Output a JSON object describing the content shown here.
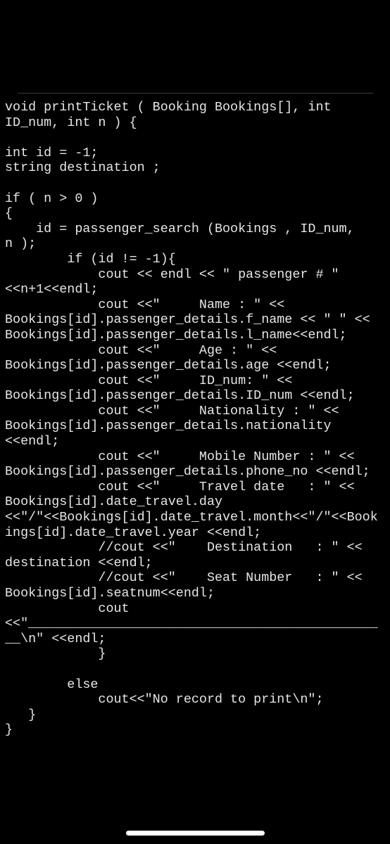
{
  "code_lines": [
    "void printTicket ( Booking Bookings[], int",
    "ID_num, int n ) {",
    "",
    "int id = -1;",
    "string destination ;",
    "",
    "if ( n > 0 )",
    "{",
    "    id = passenger_search (Bookings , ID_num,",
    "n );",
    "        if (id != -1){",
    "            cout << endl << \" passenger # \"",
    "<<n+1<<endl;",
    "            cout <<\"     Name : \" <<",
    "Bookings[id].passenger_details.f_name << \" \" <<",
    "Bookings[id].passenger_details.l_name<<endl;",
    "            cout <<\"     Age : \" <<",
    "Bookings[id].passenger_details.age <<endl;",
    "            cout <<\"     ID_num: \" <<",
    "Bookings[id].passenger_details.ID_num <<endl;",
    "            cout <<\"     Nationality : \" <<",
    "Bookings[id].passenger_details.nationality",
    "<<endl;",
    "            cout <<\"     Mobile Number : \" <<",
    "Bookings[id].passenger_details.phone_no <<endl;",
    "            cout <<\"     Travel date   : \" <<",
    "Bookings[id].date_travel.day",
    "<<\"/\"<<Bookings[id].date_travel.month<<\"/\"<<Book",
    "ings[id].date_travel.year <<endl;",
    "            //cout <<\"    Destination   : \" <<",
    "destination <<endl;",
    "            //cout <<\"    Seat Number   : \" <<",
    "Bookings[id].seatnum<<endl;",
    "            cout",
    "<<\"_____________________________________________",
    "__\\n\" <<endl;",
    "            }",
    "",
    "        else",
    "            cout<<\"No record to print\\n\";",
    "   }",
    "}"
  ],
  "colors": {
    "background": "#000000",
    "text": "#e6e6e6"
  }
}
